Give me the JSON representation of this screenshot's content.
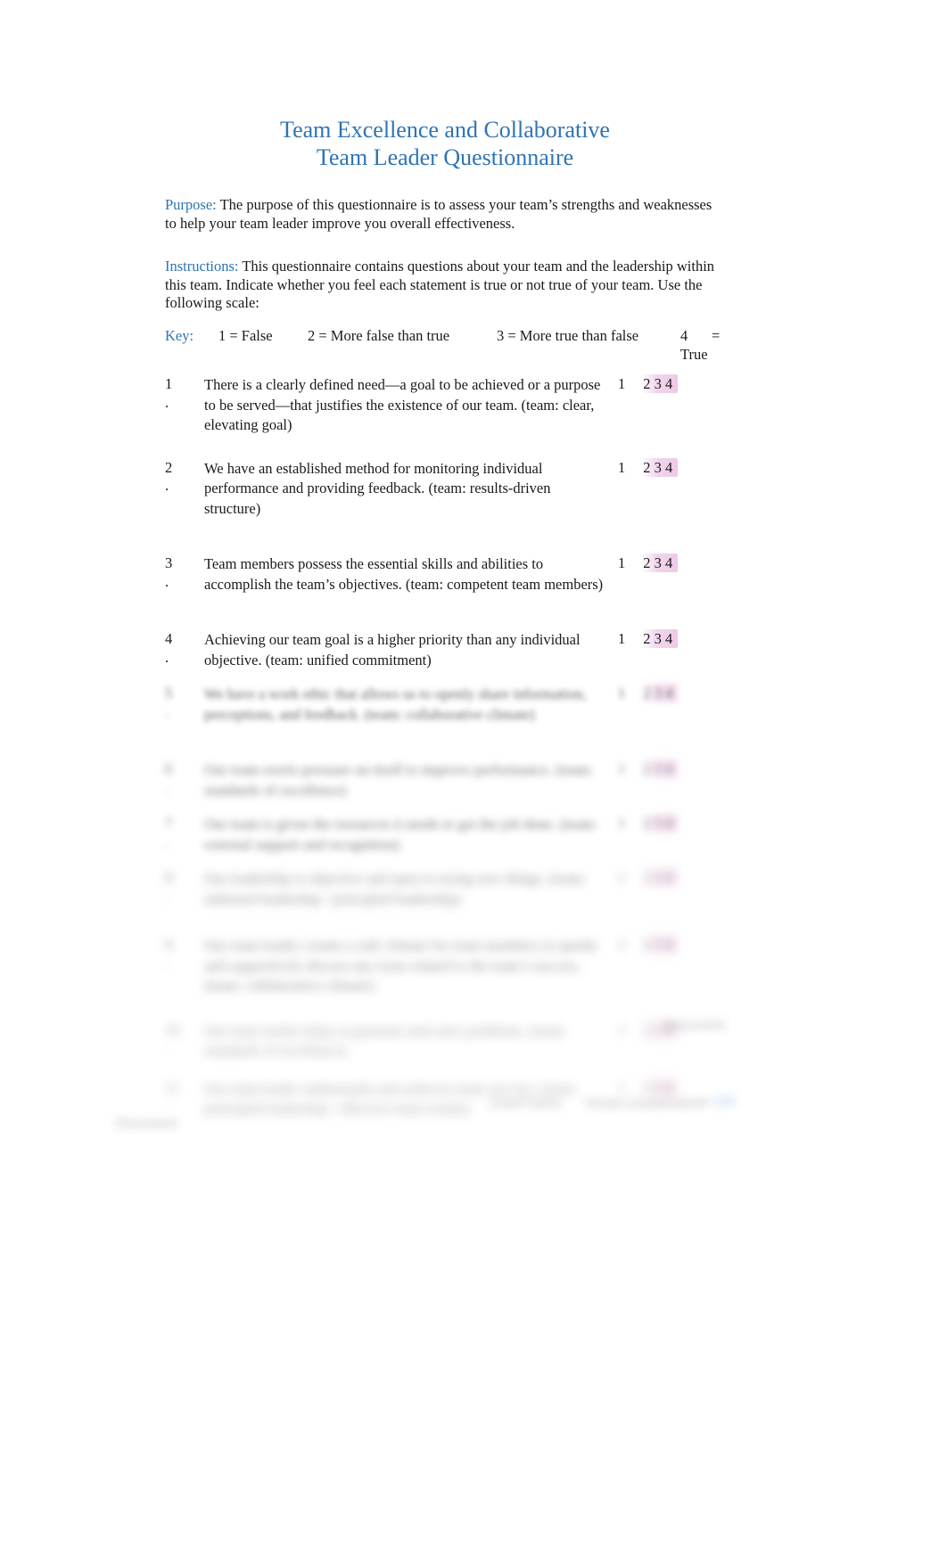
{
  "document": {
    "title_line1": "Team Excellence and Collaborative",
    "title_line2": "Team Leader Questionnaire",
    "purpose_label": "Purpose:",
    "purpose_text": " The purpose of this questionnaire is to assess your team’s strengths and weaknesses to help your team leader improve you overall effectiveness.",
    "instructions_label": "Instructions:",
    "instructions_text": " This questionnaire contains questions about your team and the leadership within this team. Indicate whether you feel each statement is true or not true of your team. Use the following scale:"
  },
  "key": {
    "label": "Key:",
    "option1": "1 = False",
    "option2": "2 = More false than true",
    "option3": "3 = More true than false",
    "option4_num": "4",
    "option4_eq": "=",
    "option4_word": "True"
  },
  "scale": {
    "value1": "1",
    "value2": "2",
    "value3": "3",
    "value4": "4",
    "highlight_color": "#eec4e4"
  },
  "questions": [
    {
      "number": "1",
      "dot": ".",
      "text": "There is a clearly defined need—a goal to be achieved or a purpose to be served—that justifies the existence of our team. (team: clear, elevating goal)",
      "blur": "none"
    },
    {
      "number": "2",
      "dot": ".",
      "text": "We have an established method for monitoring individual performance and providing feedback. (team: results-driven structure)",
      "blur": "none"
    },
    {
      "number": "3",
      "dot": ".",
      "text": "Team members possess the essential skills and abilities to accomplish the team’s objectives. (team: competent team members)",
      "blur": "none"
    },
    {
      "number": "4",
      "dot": ".",
      "text": "Achieving our team goal is a higher priority than any individual objective. (team: unified commitment)",
      "blur": "none"
    },
    {
      "number": "5",
      "dot": ".",
      "text": "We have a work ethic that allows us to openly share information, perceptions, and feedback. (team: collaborative climate)",
      "blur": "light"
    },
    {
      "number": "6",
      "dot": ".",
      "text": "Our team exerts pressure on itself to improve performance. (team: standards of excellence)",
      "blur": "medium"
    },
    {
      "number": "7",
      "dot": ".",
      "text": "Our team is given the resources it needs to get the job done. (team: external support and recognition)",
      "blur": "medium"
    },
    {
      "number": "8",
      "dot": ".",
      "text": "Our leadership is objective and open to trying new things. (team: unbiased leadership / principled leadership)",
      "blur": "heavy"
    },
    {
      "number": "9",
      "dot": ".",
      "text": "Our team leader creates a safe climate for team members to openly and supportively discuss any issue related to the team’s success. (team: collaborative climate)",
      "blur": "heavy"
    },
    {
      "number": "10",
      "dot": ".",
      "text": "Our team leader helps us generate and solve problems. (team: standards of excellence)",
      "blur": "heaviest"
    },
    {
      "number": "11",
      "dot": ".",
      "text": "Our team leader understands and achieves team success. (team: principled leadership / effective team results)",
      "blur": "heaviest"
    }
  ],
  "footer": {
    "mark_a": "Document",
    "mark_b": "CHAPTERS",
    "mark_c": "TEAM LEADERSHIP",
    "mark_d": "298",
    "mark_e": "Document"
  }
}
